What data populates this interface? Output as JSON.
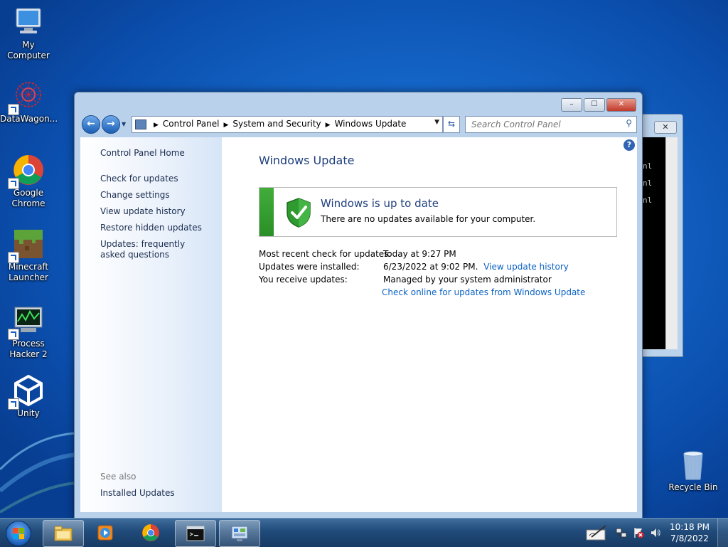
{
  "desktop": {
    "icons": [
      {
        "label": "My Computer",
        "icon": "computer-icon"
      },
      {
        "label": "DataWagon...",
        "icon": "datawagon-icon"
      },
      {
        "label": "Google Chrome",
        "icon": "chrome-icon"
      },
      {
        "label": "Minecraft Launcher",
        "icon": "minecraft-icon"
      },
      {
        "label": "Process Hacker 2",
        "icon": "process-hacker-icon"
      },
      {
        "label": "Unity",
        "icon": "unity-icon"
      },
      {
        "label": "Recycle Bin",
        "icon": "recycle-bin-icon"
      }
    ]
  },
  "cmd_window": {
    "lines": [
      "nl",
      "nl",
      "nl"
    ],
    "close_label": "✕"
  },
  "window": {
    "caption": {
      "minimize": "–",
      "maximize": "☐",
      "close": "✕"
    },
    "breadcrumbs": [
      "Control Panel",
      "System and Security",
      "Windows Update"
    ],
    "search_placeholder": "Search Control Panel"
  },
  "left_pane": {
    "home": "Control Panel Home",
    "links": [
      "Check for updates",
      "Change settings",
      "View update history",
      "Restore hidden updates",
      "Updates: frequently asked questions"
    ],
    "see_also_label": "See also",
    "see_also_links": [
      "Installed Updates"
    ]
  },
  "content": {
    "title": "Windows Update",
    "status": {
      "title": "Windows is up to date",
      "subtitle": "There are no updates available for your computer.",
      "color": "#2e9a2b"
    },
    "info": {
      "recent_check_label": "Most recent check for updates:",
      "recent_check_value": "Today at 9:27 PM",
      "installed_label": "Updates were installed:",
      "installed_value": "6/23/2022 at 9:02 PM.",
      "installed_link": "View update history",
      "receive_label": "You receive updates:",
      "receive_value": "Managed by your system administrator",
      "online_link": "Check online for updates from Windows Update"
    }
  },
  "taskbar": {
    "pinned": [
      "explorer-icon",
      "media-player-icon",
      "chrome-icon",
      "cmd-icon",
      "control-panel-icon"
    ],
    "clock_time": "10:18 PM",
    "clock_date": "7/8/2022"
  },
  "colors": {
    "link": "#0b62c4",
    "title": "#1e3f7d",
    "status_green": "#2e9a2b"
  }
}
